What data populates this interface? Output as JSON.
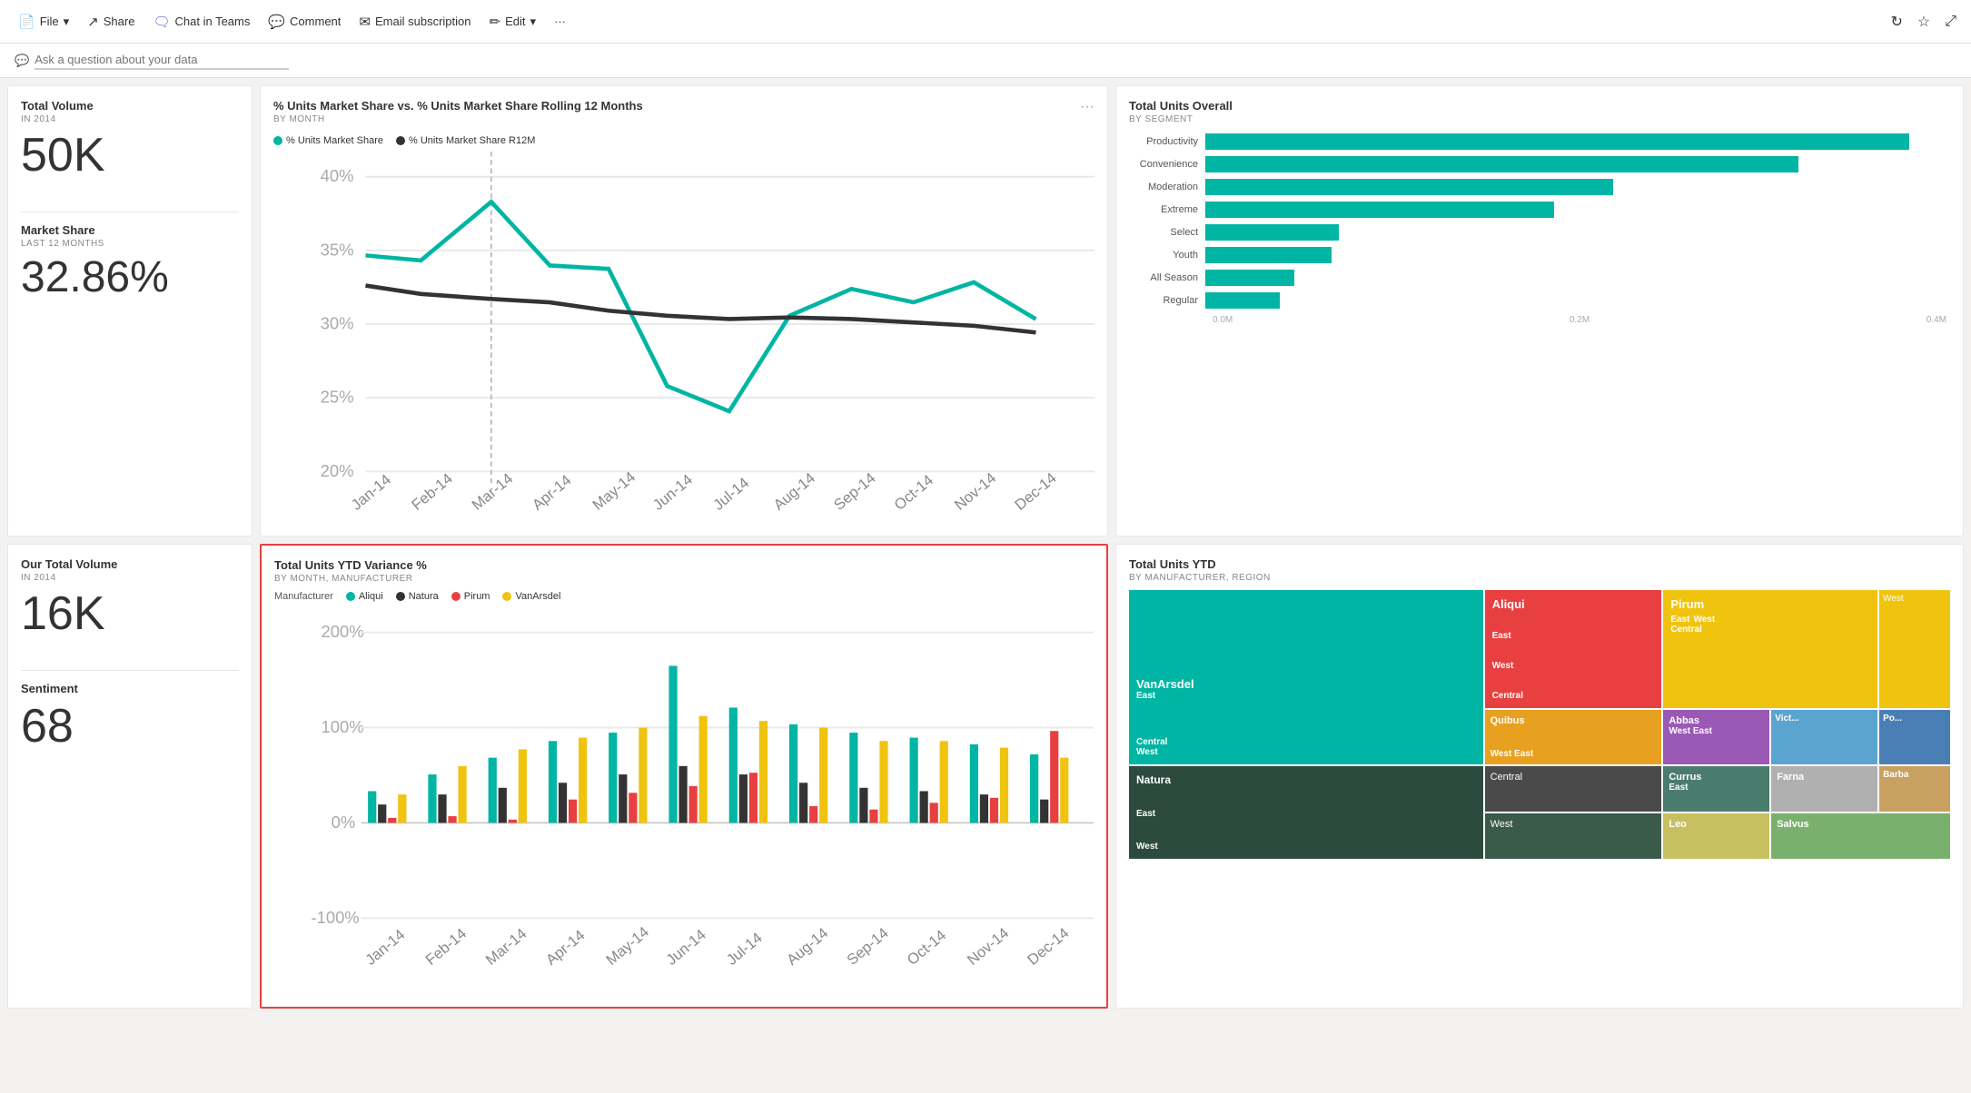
{
  "toolbar": {
    "file_label": "File",
    "share_label": "Share",
    "chat_label": "Chat in Teams",
    "comment_label": "Comment",
    "email_label": "Email subscription",
    "edit_label": "Edit",
    "more_label": "···"
  },
  "qa": {
    "placeholder": "Ask a question about your data",
    "icon": "💬"
  },
  "kpi": {
    "total_volume_title": "Total Volume",
    "total_volume_sub": "IN 2014",
    "total_volume_value": "50K",
    "market_share_title": "Market Share",
    "market_share_sub": "LAST 12 MONTHS",
    "market_share_value": "32.86%",
    "our_volume_title": "Our Total Volume",
    "our_volume_sub": "IN 2014",
    "our_volume_value": "16K",
    "sentiment_title": "Sentiment",
    "sentiment_value": "68"
  },
  "line_chart": {
    "title": "% Units Market Share vs. % Units Market Share Rolling 12 Months",
    "subtitle": "BY MONTH",
    "legend": [
      {
        "label": "% Units Market Share",
        "color": "#00b5a3"
      },
      {
        "label": "% Units Market Share R12M",
        "color": "#333"
      }
    ],
    "y_labels": [
      "40%",
      "35%",
      "30%",
      "25%",
      "20%"
    ],
    "x_labels": [
      "Jan-14",
      "Feb-14",
      "Mar-14",
      "Apr-14",
      "May-14",
      "Jun-14",
      "Jul-14",
      "Aug-14",
      "Sep-14",
      "Oct-14",
      "Nov-14",
      "Dec-14"
    ]
  },
  "bar_chart": {
    "title": "Total Units Overall",
    "subtitle": "BY SEGMENT",
    "segments": [
      {
        "label": "Productivity",
        "value": 0.95
      },
      {
        "label": "Convenience",
        "value": 0.8
      },
      {
        "label": "Moderation",
        "value": 0.55
      },
      {
        "label": "Extreme",
        "value": 0.47
      },
      {
        "label": "Select",
        "value": 0.18
      },
      {
        "label": "Youth",
        "value": 0.17
      },
      {
        "label": "All Season",
        "value": 0.12
      },
      {
        "label": "Regular",
        "value": 0.1
      }
    ],
    "x_labels": [
      "0.0M",
      "0.2M",
      "0.4M"
    ]
  },
  "variance_chart": {
    "title": "Total Units YTD Variance %",
    "subtitle": "BY MONTH, MANUFACTURER",
    "legend_label": "Manufacturer",
    "manufacturers": [
      {
        "label": "Aliqui",
        "color": "#00b5a3"
      },
      {
        "label": "Natura",
        "color": "#333"
      },
      {
        "label": "Pirum",
        "color": "#e84040"
      },
      {
        "label": "VanArsdel",
        "color": "#f0c30f"
      }
    ],
    "y_labels": [
      "200%",
      "100%",
      "0%",
      "-100%"
    ],
    "x_labels": [
      "Jan-14",
      "Feb-14",
      "Mar-14",
      "Apr-14",
      "May-14",
      "Jun-14",
      "Jul-14",
      "Aug-14",
      "Sep-14",
      "Oct-14",
      "Nov-14",
      "Dec-14"
    ]
  },
  "treemap": {
    "title": "Total Units YTD",
    "subtitle": "BY MANUFACTURER, REGION",
    "cells": [
      {
        "label": "VanArsdel",
        "sub": "East",
        "color": "#00b5a3",
        "w": 2,
        "h": 2
      },
      {
        "label": "Aliqui",
        "sub": "East",
        "color": "#e84040"
      },
      {
        "label": "Pirum",
        "sub": "East",
        "color": "#f0c30f"
      },
      {
        "label": "West",
        "color": "#e84040"
      },
      {
        "label": "Central",
        "color": "#00b5a3"
      },
      {
        "label": "West",
        "color": "#f0c30f"
      },
      {
        "label": "Central",
        "color": "#f0c30f"
      },
      {
        "label": "Quibus",
        "sub": "West East",
        "color": "#e8a020"
      },
      {
        "label": "Abbas",
        "sub": "West East",
        "color": "#9b59b6"
      },
      {
        "label": "Vict...",
        "color": "#5ba4cf"
      },
      {
        "label": "Po...",
        "color": "#5ba4cf"
      },
      {
        "label": "Central",
        "color": "#1a6e5c"
      },
      {
        "label": "West",
        "color": "#2d4a6e"
      },
      {
        "label": "Natura",
        "sub": "East",
        "color": "#2d4a3e"
      },
      {
        "label": "Central",
        "color": "#4a4a4a"
      },
      {
        "label": "Currus",
        "sub": "East",
        "color": "#4a7c6e"
      },
      {
        "label": "Farna",
        "color": "#b0b0b0"
      },
      {
        "label": "Barba",
        "color": "#c8a060"
      },
      {
        "label": "West",
        "color": "#2d4a3e"
      },
      {
        "label": "Leo",
        "color": "#c8c060"
      },
      {
        "label": "Salvus",
        "color": "#7ab06e"
      }
    ]
  },
  "colors": {
    "teal": "#00b5a3",
    "dark": "#333333",
    "red": "#e84040",
    "yellow": "#f0c30f",
    "accent": "#0078d4"
  }
}
